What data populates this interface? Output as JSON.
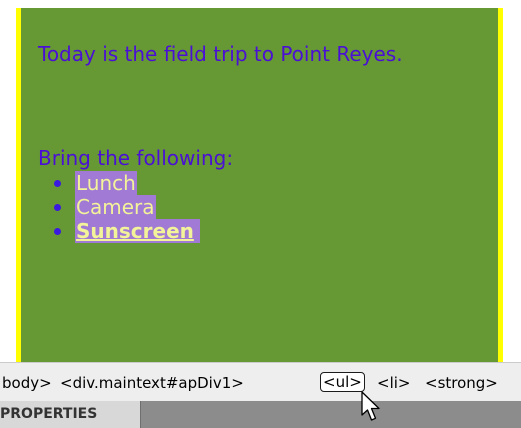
{
  "design_view": {
    "intro_text": "Today is the field trip to Point Reyes.",
    "bring_text": "Bring the following:",
    "list_items": [
      "Lunch",
      "Camera",
      "Sunscreen"
    ]
  },
  "tag_selector": {
    "tags": [
      "body>",
      "<div.maintext#apDiv1>",
      "<ul>",
      "<li>",
      "<strong>"
    ],
    "selected": "<ul>"
  },
  "panel": {
    "tab_label": "PROPERTIES"
  },
  "colors": {
    "apdiv_background": "#669933",
    "apdiv_border": "#ffff00",
    "text": "#4a0fd6",
    "list_highlight": "#a07ad4",
    "list_text": "#f3f399"
  }
}
